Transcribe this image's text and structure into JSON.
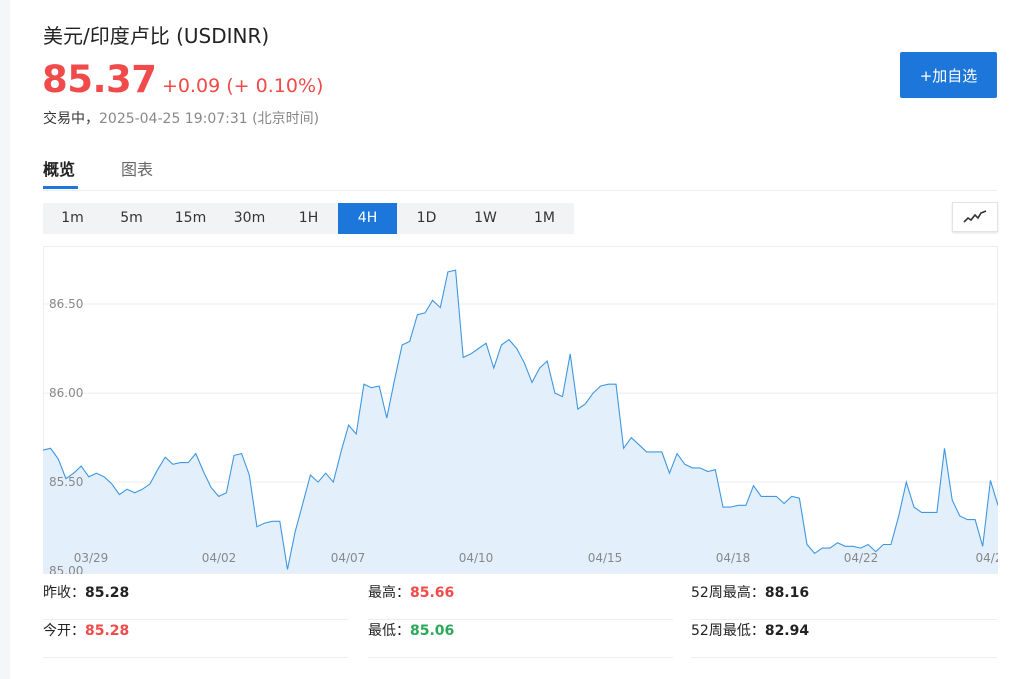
{
  "header": {
    "title": "美元/印度卢比  (USDINR)",
    "price": "85.37",
    "change": "+0.09 (+ 0.10%)",
    "status": "交易中，",
    "timestamp": "2025-04-25 19:07:31 (北京时间)",
    "add_button": "+加自选"
  },
  "tabs": [
    {
      "label": "概览",
      "active": true
    },
    {
      "label": "图表",
      "active": false
    }
  ],
  "periods": [
    "1m",
    "5m",
    "15m",
    "30m",
    "1H",
    "4H",
    "1D",
    "1W",
    "1M"
  ],
  "active_period": "4H",
  "chart_type_icon": "line-chart-icon",
  "colors": {
    "accent": "#1d76d9",
    "up": "#f04a4a",
    "down": "#2ca85a",
    "line": "#3f97e0",
    "fill": "#e3f0fc"
  },
  "chart_data": {
    "type": "area",
    "x_tick_labels": [
      "03/29",
      "04/02",
      "04/07",
      "04/10",
      "04/15",
      "04/18",
      "04/22",
      "04/2"
    ],
    "y_tick_labels": [
      "85.00",
      "85.50",
      "86.00",
      "86.50"
    ],
    "yticks": [
      85.0,
      85.5,
      86.0,
      86.5
    ],
    "ylim": [
      84.99,
      86.82
    ],
    "grid": true,
    "series": [
      {
        "values": [
          85.68,
          85.69,
          85.63,
          85.52,
          85.55,
          85.59,
          85.53,
          85.55,
          85.53,
          85.49,
          85.43,
          85.46,
          85.44,
          85.46,
          85.49,
          85.57,
          85.64,
          85.6,
          85.61,
          85.61,
          85.66,
          85.56,
          85.47,
          85.42,
          85.44,
          85.65,
          85.66,
          85.54,
          85.25,
          85.27,
          85.28,
          85.28,
          85.01,
          85.22,
          85.38,
          85.54,
          85.5,
          85.55,
          85.5,
          85.67,
          85.82,
          85.77,
          86.05,
          86.03,
          86.04,
          85.86,
          86.07,
          86.27,
          86.29,
          86.44,
          86.45,
          86.52,
          86.48,
          86.68,
          86.69,
          86.2,
          86.22,
          86.25,
          86.28,
          86.14,
          86.27,
          86.3,
          86.25,
          86.17,
          86.06,
          86.14,
          86.18,
          86.0,
          85.98,
          86.22,
          85.91,
          85.94,
          86.0,
          86.04,
          86.05,
          86.05,
          85.69,
          85.75,
          85.71,
          85.67,
          85.67,
          85.67,
          85.55,
          85.66,
          85.6,
          85.58,
          85.58,
          85.56,
          85.57,
          85.36,
          85.36,
          85.37,
          85.37,
          85.48,
          85.42,
          85.42,
          85.42,
          85.38,
          85.42,
          85.41,
          85.15,
          85.1,
          85.13,
          85.13,
          85.16,
          85.14,
          85.14,
          85.13,
          85.15,
          85.11,
          85.15,
          85.15,
          85.31,
          85.5,
          85.36,
          85.33,
          85.33,
          85.33,
          85.69,
          85.4,
          85.31,
          85.29,
          85.29,
          85.14,
          85.51,
          85.37
        ]
      }
    ]
  },
  "stats": {
    "prev_close": {
      "label": "昨收：",
      "value": "85.28"
    },
    "open": {
      "label": "今开：",
      "value": "85.28"
    },
    "high": {
      "label": "最高：",
      "value": "85.66"
    },
    "low": {
      "label": "最低：",
      "value": "85.06"
    },
    "w52_high": {
      "label": "52周最高：",
      "value": "88.16"
    },
    "w52_low": {
      "label": "52周最低：",
      "value": "82.94"
    }
  }
}
